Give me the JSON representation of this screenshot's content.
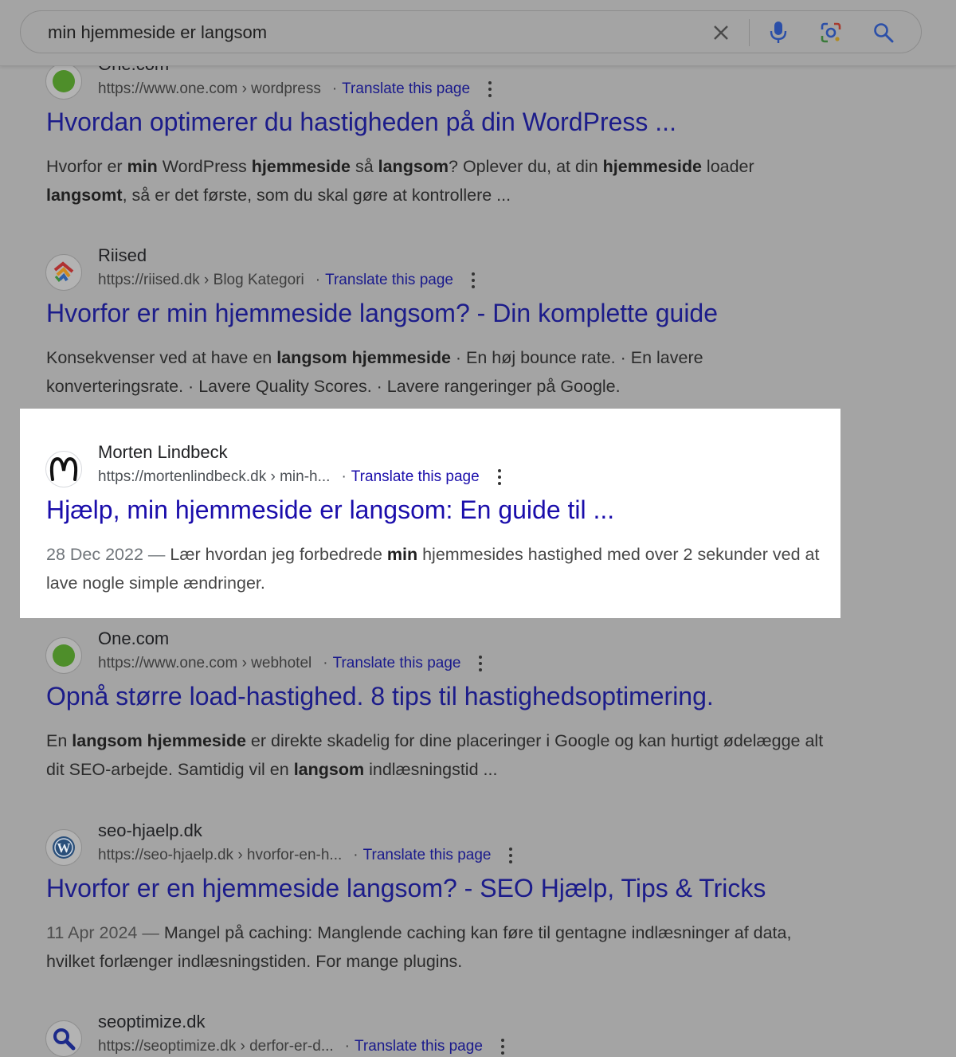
{
  "search": {
    "query": "min hjemmeside er langsom"
  },
  "results": [
    {
      "site": "One.com",
      "url": "https://www.one.com › wordpress",
      "translate": "Translate this page",
      "title": "Hvordan optimerer du hastigheden på din WordPress ...",
      "snippet": [
        {
          "t": "Hvorfor er ",
          "b": false
        },
        {
          "t": "min",
          "b": true
        },
        {
          "t": " WordPress ",
          "b": false
        },
        {
          "t": "hjemmeside",
          "b": true
        },
        {
          "t": " så ",
          "b": false
        },
        {
          "t": "langsom",
          "b": true
        },
        {
          "t": "? Oplever du, at din ",
          "b": false
        },
        {
          "t": "hjemmeside",
          "b": true
        },
        {
          "t": " loader ",
          "b": false
        },
        {
          "t": "langsomt",
          "b": true
        },
        {
          "t": ", så er det første, som du skal gøre at kontrollere ...",
          "b": false
        }
      ],
      "favicon": "green-dot-icon",
      "highlight": false
    },
    {
      "site": "Riised",
      "url": "https://riised.dk › Blog Kategori",
      "translate": "Translate this page",
      "title": "Hvorfor er min hjemmeside langsom? - Din komplette guide",
      "snippet": [
        {
          "t": "Konsekvenser ved at have en ",
          "b": false
        },
        {
          "t": "langsom hjemmeside",
          "b": true
        },
        {
          "t": " · En høj bounce rate. · En lavere konverteringsrate. · Lavere Quality Scores. · Lavere rangeringer på Google.",
          "b": false
        }
      ],
      "favicon": "riised-logo-icon",
      "highlight": false
    },
    {
      "site": "Morten Lindbeck",
      "url": "https://mortenlindbeck.dk › min-h...",
      "translate": "Translate this page",
      "title": "Hjælp, min hjemmeside er langsom: En guide til ...",
      "date": "28 Dec 2022 — ",
      "snippet": [
        {
          "t": "Lær hvordan jeg forbedrede ",
          "b": false
        },
        {
          "t": "min",
          "b": true
        },
        {
          "t": " hjemmesides hastighed med over 2 sekunder ved at lave nogle simple ændringer.",
          "b": false
        }
      ],
      "favicon": "m-logo-icon",
      "highlight": true
    },
    {
      "site": "One.com",
      "url": "https://www.one.com › webhotel",
      "translate": "Translate this page",
      "title": "Opnå større load-hastighed. 8 tips til hastighedsoptimering.",
      "snippet": [
        {
          "t": "En ",
          "b": false
        },
        {
          "t": "langsom hjemmeside",
          "b": true
        },
        {
          "t": " er direkte skadelig for dine placeringer i Google og kan hurtigt ødelægge alt dit SEO-arbejde. Samtidig vil en ",
          "b": false
        },
        {
          "t": "langsom",
          "b": true
        },
        {
          "t": " indlæsningstid ...",
          "b": false
        }
      ],
      "favicon": "green-dot-icon",
      "highlight": false
    },
    {
      "site": "seo-hjaelp.dk",
      "url": "https://seo-hjaelp.dk › hvorfor-en-h...",
      "translate": "Translate this page",
      "title": "Hvorfor er en hjemmeside langsom? - SEO Hjælp, Tips & Tricks",
      "date": "11 Apr 2024 — ",
      "snippet": [
        {
          "t": "Mangel på caching: Manglende caching kan føre til gentagne indlæsninger af data, hvilket forlænger indlæsningstiden. For mange plugins.",
          "b": false
        }
      ],
      "favicon": "wordpress-icon",
      "highlight": false
    },
    {
      "site": "seoptimize.dk",
      "url": "https://seoptimize.dk › derfor-er-d...",
      "translate": "Translate this page",
      "title": "",
      "snippet": [],
      "favicon": "magnifier-logo-icon",
      "highlight": false
    }
  ]
}
